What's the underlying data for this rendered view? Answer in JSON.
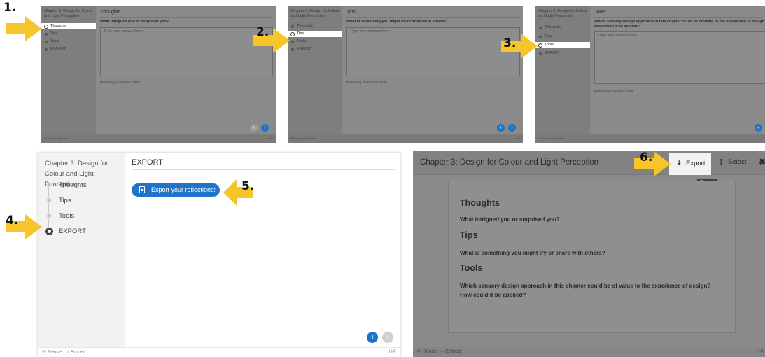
{
  "chapter_title": "Chapter 3: Design for Colour and Light Perception",
  "sidebar_items": [
    "Thoughts",
    "Tips",
    "Tools",
    "EXPORT"
  ],
  "remaining_chars": "Remaining characters: 1000",
  "placeholder": "Type your answer here",
  "footer": {
    "reuse": "Reuse",
    "embed": "Embed",
    "hp": "H-P"
  },
  "panels": [
    {
      "title": "Thoughts",
      "question": "What intrigued you or surprised you?",
      "active_index": 0
    },
    {
      "title": "Tips",
      "question": "What is something you might try or share with others?",
      "active_index": 1
    },
    {
      "title": "Tools",
      "question": "Which sensory design approach in this chapter could be of value to the experience of design? How could it be applied?",
      "active_index": 2
    }
  ],
  "export_panel": {
    "title": "EXPORT",
    "button_label": "Export your reflections!"
  },
  "dialog": {
    "title": "Chapter 3: Design for Colour and Light Perception",
    "export_label": "Export",
    "select_label": "Select",
    "tooltip": "Export",
    "sections": [
      {
        "heading": "Thoughts",
        "question": "What intrigued you or surprised you?"
      },
      {
        "heading": "Tips",
        "question": "What is something you might try or share with others?"
      },
      {
        "heading": "Tools",
        "question": "Which sensory design approach in this chapter could be of value to the experience of design? How could it be applied?"
      }
    ]
  },
  "step_numbers": [
    "1.",
    "2.",
    "3.",
    "4.",
    "5.",
    "6."
  ],
  "colors": {
    "arrow": "#f7c42a",
    "button_blue": "#1f73c9",
    "dim_gray": "#8a8a8a"
  }
}
